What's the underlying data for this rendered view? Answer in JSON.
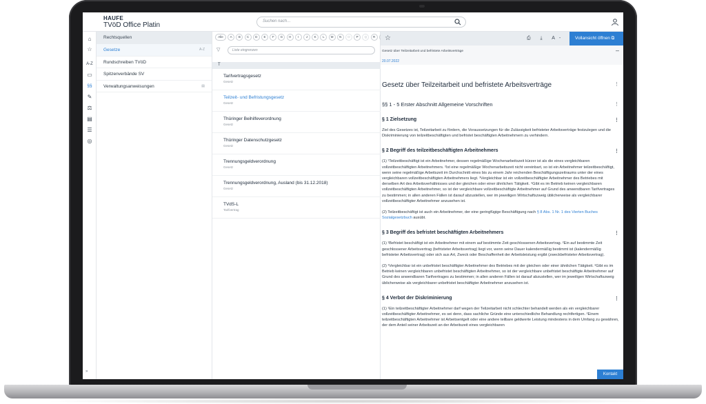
{
  "header": {
    "brand_top": "HAUFE",
    "brand_sub": "TVöD Office Platin",
    "search_placeholder": "Suchen nach…"
  },
  "rail": {
    "icons": [
      "home-icon",
      "star-icon",
      "az-icon",
      "id-card-icon",
      "paragraph-icon",
      "note-icon",
      "scale-icon",
      "calendar-icon",
      "list-icon",
      "coins-icon"
    ],
    "labels": [
      "⌂",
      "☆",
      "A-Z",
      "▭",
      "§§",
      "✎",
      "⚖",
      "▤",
      "☰",
      "◎"
    ],
    "collapse": "»"
  },
  "categories": {
    "header": "Rechtsquellen",
    "items": [
      {
        "label": "Gesetze",
        "extra": "A-Z",
        "active": true
      },
      {
        "label": "Rundschreiben TVöD",
        "extra": "",
        "active": false
      },
      {
        "label": "Spitzenverbände SV",
        "extra": "",
        "active": false
      },
      {
        "label": "Verwaltungsanweisungen",
        "extra": "▤",
        "active": false
      }
    ]
  },
  "alphabet": {
    "letters": [
      "Alle",
      "A",
      "B",
      "C",
      "D",
      "E",
      "F",
      "G",
      "H",
      "I",
      "J",
      "K",
      "L",
      "M",
      "N",
      "O",
      "P",
      "Q",
      "R",
      "S",
      "T",
      "U",
      "V",
      "W",
      "X",
      "Y",
      "Z"
    ],
    "disabled": [
      "O",
      "Q",
      "X",
      "Y"
    ],
    "active": "T"
  },
  "filter": {
    "placeholder": "Liste eingrenzen"
  },
  "list": {
    "group": "T",
    "items": [
      {
        "title": "Tarifvertragsgesetz",
        "sub": "Gesetz",
        "active": false
      },
      {
        "title": "Teilzeit- und Befristungsgesetz",
        "sub": "Gesetz",
        "active": true
      },
      {
        "title": "Thüringer Beihilfeverordnung",
        "sub": "Gesetz",
        "active": false
      },
      {
        "title": "Thüringer Datenschutzgesetz",
        "sub": "Gesetz",
        "active": false
      },
      {
        "title": "Trennungsgeldverordnung",
        "sub": "Gesetz",
        "active": false
      },
      {
        "title": "Trennungsgeldverordnung, Ausland (bis 31.12.2018)",
        "sub": "Gesetz",
        "active": false
      },
      {
        "title": "TVdS-L",
        "sub": "Tarifvertrag",
        "active": false
      }
    ]
  },
  "document": {
    "toolbar": {
      "icons": "⎙ ⤓ A- A+",
      "full_view": "Vollansicht öffnen"
    },
    "breadcrumb": "Gesetz über Teilzeitarbeit und befristete Arbeitsverträge",
    "date": "20.07.2022",
    "title": "Gesetz über Teilzeitarbeit und befristete Arbeitsverträge",
    "section_title": "§§ 1 - 5 Erster Abschnitt Allgemeine Vorschriften",
    "p1_title": "§ 1 Zielsetzung",
    "p1_text": "Ziel des Gesetzes ist, Teilzeitarbeit zu fördern, die Voraussetzungen für die Zulässigkeit befristeter Arbeitsverträge festzulegen und die Diskriminierung von teilzeitbeschäftigten und befristet beschäftigten Arbeitnehmern zu verhindern.",
    "p2_title": "§ 2 Begriff des teilzeitbeschäftigten Arbeitnehmers",
    "p2_text1": "(1) ¹Teilzeitbeschäftigt ist ein Arbeitnehmer, dessen regelmäßige Wochenarbeitszeit kürzer ist als die eines vergleichbaren vollzeitbeschäftigten Arbeitnehmers. ²Ist eine regelmäßige Wochenarbeitszeit nicht vereinbart, so ist ein Arbeitnehmer teilzeitbeschäftigt, wenn seine regelmäßige Arbeitszeit im Durchschnitt eines bis zu einem Jahr reichenden Beschäftigungszeitraums unter der eines vergleichbaren vollzeitbeschäftigten Arbeitnehmers liegt. ³Vergleichbar ist ein vollzeitbeschäftigter Arbeitnehmer des Betriebes mit derselben Art des Arbeitsverhältnisses und der gleichen oder einer ähnlichen Tätigkeit. ⁴Gibt es im Betrieb keinen vergleichbaren vollzeitbeschäftigten Arbeitnehmer, so ist der vergleichbare vollzeitbeschäftigte Arbeitnehmer auf Grund des anwendbaren Tarifvertrages zu bestimmen; in allen anderen Fällen ist darauf abzustellen, wer im jeweiligen Wirtschaftszweig üblicherweise als vergleichbarer vollzeitbeschäftigter Arbeitnehmer anzusehen ist.",
    "p2_text2_a": "(2) Teilzeitbeschäftigt ist auch ein Arbeitnehmer, der eine geringfügige Beschäftigung nach",
    "p2_text2_link": "§ 8 Abs. 1 Nr. 1 des Vierten Buches Sozialgesetzbuch",
    "p2_text2_b": "ausübt.",
    "p3_title": "§ 3 Begriff des befristet beschäftigten Arbeitnehmers",
    "p3_text1": "(1) ¹Befristet beschäftigt ist ein Arbeitnehmer mit einem auf bestimmte Zeit geschlossenen Arbeitsvertrag. ²Ein auf bestimmte Zeit geschlossener Arbeitsvertrag (befristeter Arbeitsvertrag) liegt vor, wenn seine Dauer kalendermäßig bestimmt ist (kalendermäßig befristeter Arbeitsvertrag) oder sich aus Art, Zweck oder Beschaffenheit der Arbeitsleistung ergibt (zweckbefristeter Arbeitsvertrag).",
    "p3_text2": "(2) ¹Vergleichbar ist ein unbefristet beschäftigter Arbeitnehmer des Betriebes mit der gleichen oder einer ähnlichen Tätigkeit. ²Gibt es im Betrieb keinen vergleichbaren unbefristet beschäftigten Arbeitnehmer, so ist der vergleichbare unbefristet beschäftigte Arbeitnehmer auf Grund des anwendbaren Tarifvertrages zu bestimmen; in allen anderen Fällen ist darauf abzustellen, wer im jeweiligen Wirtschaftszweig üblicherweise als vergleichbarer unbefristet beschäftigter Arbeitnehmer anzusehen ist.",
    "p4_title": "§ 4 Verbot der Diskriminierung",
    "p4_text": "(1) ¹Ein teilzeitbeschäftigter Arbeitnehmer darf wegen der Teilzeitarbeit nicht schlechter behandelt werden als ein vergleichbarer vollzeitbeschäftigter Arbeitnehmer, es sei denn, dass sachliche Gründe eine unterschiedliche Behandlung rechtfertigen. ²Einem teilzeitbeschäftigten Arbeitnehmer ist Arbeitsentgelt oder eine andere teilbare geldwerte Leistung mindestens in dem Umfang zu gewähren, der dem Anteil seiner Arbeitszeit an der Arbeitszeit eines vergleichbaren",
    "contact": "Kontakt"
  },
  "colors": {
    "accent": "#2d7fd3",
    "panel": "#e8ecf0",
    "frame": "#1b1b1d"
  }
}
